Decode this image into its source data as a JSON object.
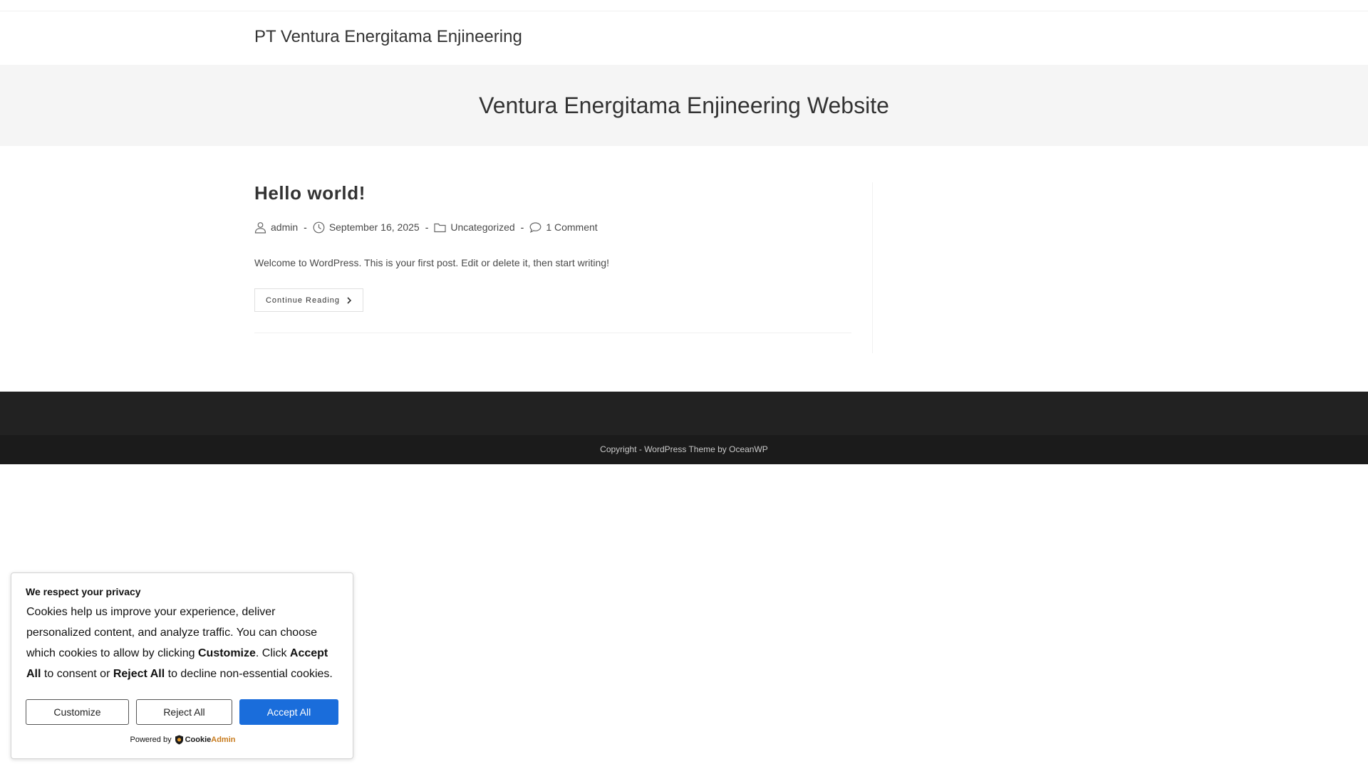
{
  "header": {
    "site_title": "PT Ventura Energitama Enjineering"
  },
  "page_header": {
    "title": "Ventura Energitama Enjineering Website"
  },
  "post": {
    "title": "Hello world!",
    "meta": {
      "author": "admin",
      "date": "September 16, 2025",
      "category": "Uncategorized",
      "comments": "1 Comment",
      "separator": "-"
    },
    "excerpt": "Welcome to WordPress. This is your first post. Edit or delete it, then start writing!",
    "continue_label": "Continue Reading"
  },
  "footer": {
    "copyright": "Copyright - WordPress Theme by OceanWP"
  },
  "cookie_banner": {
    "title": "We respect your privacy",
    "text_1": "Cookies help us improve your experience, deliver personalized content, and analyze traffic. You can choose which cookies to allow by clicking ",
    "bold_customize": "Customize",
    "text_2": ". Click ",
    "bold_accept": "Accept All",
    "text_3": " to consent or ",
    "bold_reject": "Reject All",
    "text_4": " to decline non-essential cookies.",
    "customize_label": "Customize",
    "reject_label": "Reject All",
    "accept_label": "Accept All",
    "powered_by": "Powered by",
    "logo_text_a": "Cookie",
    "logo_text_b": "Admin"
  },
  "colors": {
    "accept_button": "#1a6ddb",
    "footer_widgets": "#222222",
    "footer_bottom": "#1b1b1b",
    "page_header_bg": "#f5f5f5"
  },
  "icons": {
    "author": "user-icon",
    "date": "clock-icon",
    "category": "folder-icon",
    "comments": "comment-icon",
    "continue": "chevron-right-icon",
    "logo": "shield-icon"
  }
}
